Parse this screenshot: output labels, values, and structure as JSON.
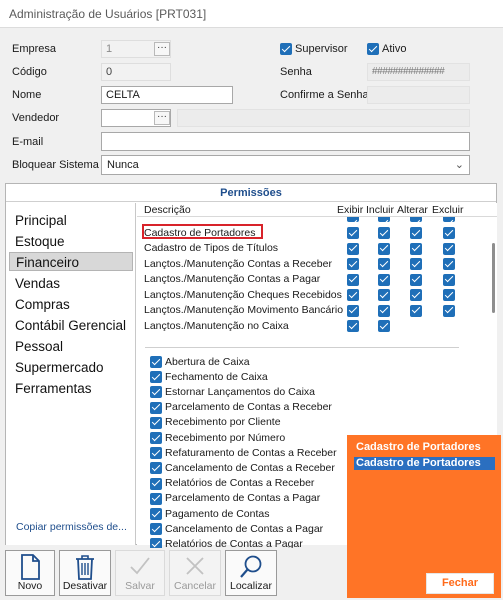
{
  "window": {
    "title": "Administração de Usuários [PRT031]"
  },
  "form": {
    "empresa": {
      "label": "Empresa",
      "value": "1",
      "btn": "···"
    },
    "codigo": {
      "label": "Código",
      "value": "0"
    },
    "nome": {
      "label": "Nome",
      "value": "CELTA"
    },
    "vendedor": {
      "label": "Vendedor",
      "value": "",
      "btn": "···"
    },
    "email": {
      "label": "E-mail",
      "value": ""
    },
    "bloquear": {
      "label": "Bloquear Sistema",
      "value": "Nunca"
    },
    "supervisor": {
      "label": "Supervisor",
      "checked": true
    },
    "ativo": {
      "label": "Ativo",
      "checked": true
    },
    "senha": {
      "label": "Senha",
      "value": "##############"
    },
    "confirme": {
      "label": "Confirme a Senha",
      "value": ""
    }
  },
  "permissoes": {
    "title": "Permissões",
    "categories": [
      "Principal",
      "Estoque",
      "Financeiro",
      "Vendas",
      "Compras",
      "Contábil Gerencial",
      "Pessoal",
      "Supermercado",
      "Ferramentas"
    ],
    "selected": "Financeiro",
    "copy_link": "Copiar permissões de...",
    "columns": {
      "descricao": "Descrição",
      "exibir": "Exibir",
      "incluir": "Incluir",
      "alterar": "Alterar",
      "excluir": "Excluir"
    },
    "rows": [
      {
        "label": "Cadastro de Portadores",
        "exibir": true,
        "incluir": true,
        "alterar": true,
        "excluir": true
      },
      {
        "label": "Cadastro de Tipos de Títulos",
        "exibir": true,
        "incluir": true,
        "alterar": true,
        "excluir": true
      },
      {
        "label": "Lançtos./Manutenção Contas a Receber",
        "exibir": true,
        "incluir": true,
        "alterar": true,
        "excluir": true
      },
      {
        "label": "Lançtos./Manutenção Contas a Pagar",
        "exibir": true,
        "incluir": true,
        "alterar": true,
        "excluir": true
      },
      {
        "label": "Lançtos./Manutenção Cheques Recebidos",
        "exibir": true,
        "incluir": true,
        "alterar": true,
        "excluir": true
      },
      {
        "label": "Lançtos./Manutenção Movimento Bancário",
        "exibir": true,
        "incluir": true,
        "alterar": true,
        "excluir": true
      },
      {
        "label": "Lançtos./Manutenção no Caixa",
        "exibir": true,
        "incluir": true,
        "alterar": false,
        "excluir": false
      }
    ],
    "checklist": [
      "Abertura de Caixa",
      "Fechamento de Caixa",
      "Estornar Lançamentos do Caixa",
      "Parcelamento de Contas a Receber",
      "Recebimento por Cliente",
      "Recebimento por Número",
      "Refaturamento de Contas a Receber",
      "Cancelamento de Contas a Receber",
      "Relatórios de Contas a Receber",
      "Parcelamento de Contas a Pagar",
      "Pagamento de Contas",
      "Cancelamento de Contas a Pagar",
      "Relatórios de Contas a Pagar"
    ]
  },
  "toolbar": {
    "novo": "Novo",
    "desativar": "Desativar",
    "salvar": "Salvar",
    "cancelar": "Cancelar",
    "localizar": "Localizar"
  },
  "popup": {
    "items": [
      "Cadastro de Portadores",
      "Cadastro de Portadores"
    ],
    "selected_index": 1,
    "close": "Fechar"
  },
  "colors": {
    "accent": "#1f6fb8",
    "popup": "#ff7426",
    "highlight": "#d8232a",
    "title_blue": "#1f4e8c"
  }
}
